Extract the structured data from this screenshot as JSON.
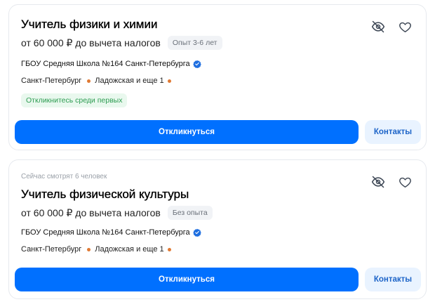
{
  "colors": {
    "accent": "#0070ff",
    "contacts_bg": "#e9f3ff",
    "contacts_text": "#1d64c8",
    "early_badge_bg": "#e9f8ee",
    "early_badge_text": "#2e9c52",
    "metro_dot": "#e07a34",
    "verified": "#1f6fe0"
  },
  "vacancies": [
    {
      "notice": "",
      "title": "Учитель физики и химии",
      "salary": "от 60 000 ₽ до вычета налогов",
      "experience": "Опыт 3-6 лет",
      "employer": "ГБОУ Средняя Школа №164 Санкт-Петербурга",
      "employer_verified_icon": "verified-check-icon",
      "city": "Санкт-Петербург",
      "metro": "Ладожская и еще 1",
      "badge": "Откликнитесь среди первых",
      "apply_label": "Откликнуться",
      "contacts_label": "Контакты",
      "hide_icon": "eye-off-icon",
      "favorite_icon": "heart-icon"
    },
    {
      "notice": "Сейчас смотрят 6 человек",
      "title": "Учитель физической культуры",
      "salary": "от 60 000 ₽ до вычета налогов",
      "experience": "Без опыта",
      "employer": "ГБОУ Средняя Школа №164 Санкт-Петербурга",
      "employer_verified_icon": "verified-check-icon",
      "city": "Санкт-Петербург",
      "metro": "Ладожская и еще 1",
      "badge": "",
      "apply_label": "Откликнуться",
      "contacts_label": "Контакты",
      "hide_icon": "eye-off-icon",
      "favorite_icon": "heart-icon"
    }
  ]
}
